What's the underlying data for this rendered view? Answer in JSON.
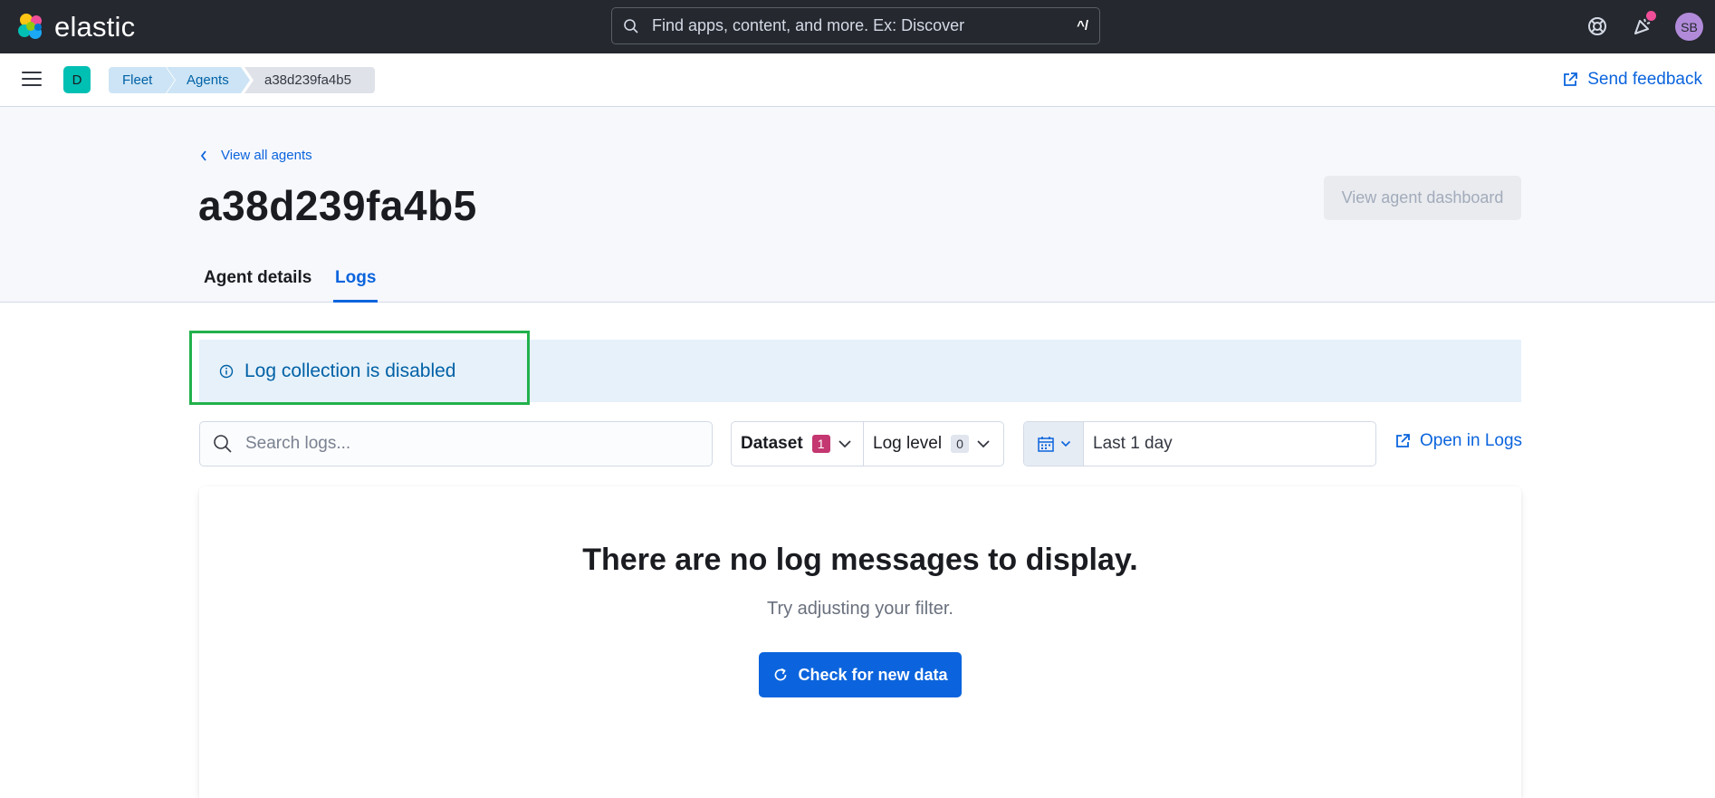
{
  "header": {
    "brand": "elastic",
    "search_placeholder": "Find apps, content, and more. Ex: Discover",
    "search_shortcut": "^/",
    "avatar_initials": "SB"
  },
  "crumbbar": {
    "space_initial": "D",
    "breadcrumbs": [
      "Fleet",
      "Agents",
      "a38d239fa4b5"
    ],
    "feedback_label": "Send feedback"
  },
  "page": {
    "back_label": "View all agents",
    "title": "a38d239fa4b5",
    "dashboard_button": "View agent dashboard",
    "tabs": [
      {
        "label": "Agent details",
        "active": false
      },
      {
        "label": "Logs",
        "active": true
      }
    ]
  },
  "callout": {
    "text": "Log collection is disabled"
  },
  "filters": {
    "search_placeholder": "Search logs...",
    "dataset_label": "Dataset",
    "dataset_count": "1",
    "loglevel_label": "Log level",
    "loglevel_count": "0",
    "date_range": "Last 1 day",
    "open_in_logs": "Open in Logs"
  },
  "empty_state": {
    "title": "There are no log messages to display.",
    "subtitle": "Try adjusting your filter.",
    "button": "Check for new data"
  },
  "colors": {
    "header_bg": "#25282f",
    "link": "#0b64dd",
    "callout_bg": "#e6f1fa",
    "highlight": "#22b14c",
    "primary_button": "#0b64dd"
  }
}
